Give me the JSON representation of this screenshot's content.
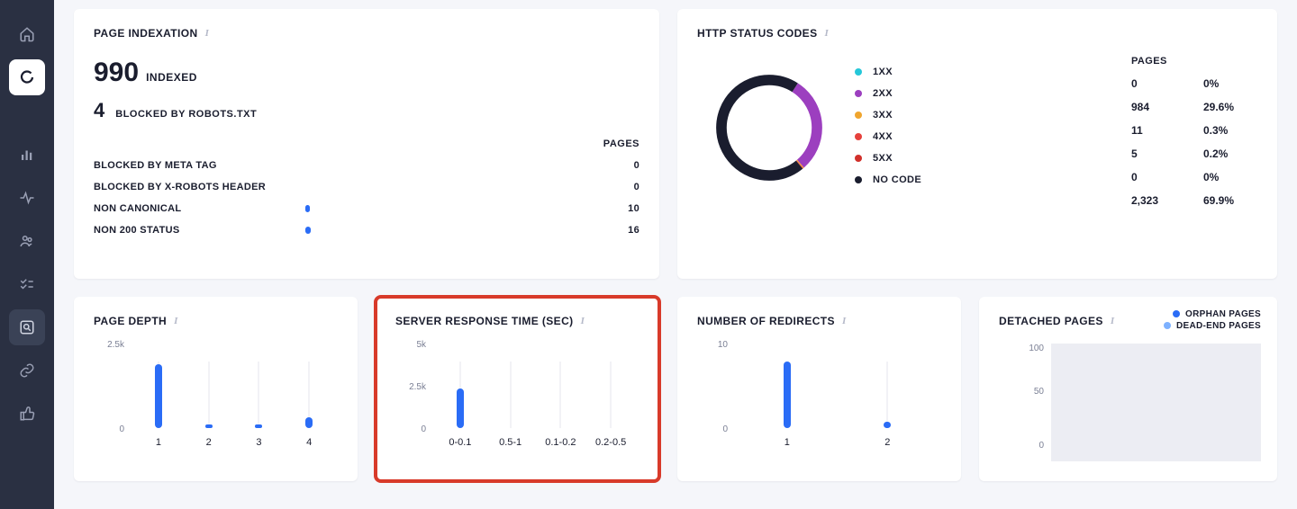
{
  "colors": {
    "blue": "#2a6cf6",
    "lightblue": "#7db1ff",
    "purple": "#9c3fbf",
    "cyan": "#25c7d9",
    "orange": "#f0a52e",
    "red": "#e6413c",
    "darkred": "#d1302b",
    "black": "#1a1d2e",
    "highlight": "#d83a2a"
  },
  "sidebar": {
    "items": [
      {
        "name": "home-icon"
      },
      {
        "name": "logo-icon"
      },
      {
        "name": "analytics-icon"
      },
      {
        "name": "activity-icon"
      },
      {
        "name": "users-icon"
      },
      {
        "name": "checklist-icon"
      },
      {
        "name": "inspect-icon"
      },
      {
        "name": "link-icon"
      },
      {
        "name": "thumb-icon"
      }
    ]
  },
  "indexation": {
    "title": "PAGE INDEXATION",
    "info": "i",
    "indexed_count": "990",
    "indexed_label": "INDEXED",
    "blocked_count": "4",
    "blocked_label": "BLOCKED BY ROBOTS.TXT",
    "pages_header": "PAGES",
    "rows": [
      {
        "label": "BLOCKED BY META TAG",
        "value": "0",
        "pct": 0
      },
      {
        "label": "BLOCKED BY X-ROBOTS HEADER",
        "value": "0",
        "pct": 0
      },
      {
        "label": "NON CANONICAL",
        "value": "10",
        "pct": 1.5
      },
      {
        "label": "NON 200 STATUS",
        "value": "16",
        "pct": 2
      }
    ]
  },
  "http": {
    "title": "HTTP STATUS CODES",
    "info": "i",
    "pages_header": "PAGES",
    "legend": [
      {
        "label": "1XX",
        "color": "#25c7d9",
        "count": "0",
        "pct": "0%"
      },
      {
        "label": "2XX",
        "color": "#9c3fbf",
        "count": "984",
        "pct": "29.6%"
      },
      {
        "label": "3XX",
        "color": "#f0a52e",
        "count": "11",
        "pct": "0.3%"
      },
      {
        "label": "4XX",
        "color": "#e6413c",
        "count": "5",
        "pct": "0.2%"
      },
      {
        "label": "5XX",
        "color": "#d1302b",
        "count": "0",
        "pct": "0%"
      },
      {
        "label": "NO CODE",
        "color": "#1a1d2e",
        "count": "2,323",
        "pct": "69.9%"
      }
    ],
    "donut": {
      "nocode_pct": 69.9,
      "two_pct": 29.6,
      "three_pct": 0.3,
      "four_pct": 0.2
    }
  },
  "page_depth": {
    "title": "PAGE DEPTH",
    "info": "i"
  },
  "srt": {
    "title": "SERVER RESPONSE TIME (SEC)",
    "info": "i"
  },
  "redirects": {
    "title": "NUMBER OF REDIRECTS",
    "info": "i"
  },
  "detached": {
    "title": "DETACHED PAGES",
    "info": "i",
    "legend": {
      "orphan": "ORPHAN PAGES",
      "deadend": "DEAD-END PAGES"
    }
  },
  "chart_data": [
    {
      "id": "page_depth",
      "type": "bar",
      "title": "PAGE DEPTH",
      "xlabel": "",
      "ylabel": "",
      "ylim": [
        0,
        2500
      ],
      "yticks": [
        "2.5k",
        "0"
      ],
      "categories": [
        "1",
        "2",
        "3",
        "4"
      ],
      "values": [
        2400,
        40,
        120,
        400
      ]
    },
    {
      "id": "server_response_time",
      "type": "bar",
      "title": "SERVER RESPONSE TIME (SEC)",
      "xlabel": "",
      "ylabel": "",
      "ylim": [
        0,
        5000
      ],
      "yticks": [
        "5k",
        "2.5k",
        "0"
      ],
      "categories": [
        "0-0.1",
        "0.5-1",
        "0.1-0.2",
        "0.2-0.5"
      ],
      "values": [
        3000,
        0,
        0,
        0
      ]
    },
    {
      "id": "number_of_redirects",
      "type": "bar",
      "title": "NUMBER OF REDIRECTS",
      "xlabel": "",
      "ylabel": "",
      "ylim": [
        0,
        10
      ],
      "yticks": [
        "10",
        "0"
      ],
      "categories": [
        "1",
        "2"
      ],
      "values": [
        10,
        1
      ]
    },
    {
      "id": "detached_pages",
      "type": "area",
      "title": "DETACHED PAGES",
      "xlabel": "",
      "ylabel": "",
      "ylim": [
        0,
        100
      ],
      "yticks": [
        "100",
        "50",
        "0"
      ],
      "series": [
        {
          "name": "ORPHAN PAGES",
          "color": "#2a6cf6"
        },
        {
          "name": "DEAD-END PAGES",
          "color": "#7db1ff"
        }
      ]
    }
  ]
}
